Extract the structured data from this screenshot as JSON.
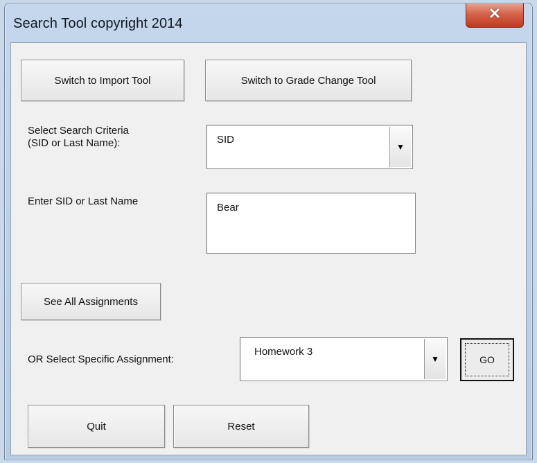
{
  "window": {
    "title": "Search Tool copyright 2014",
    "close_glyph": "✕"
  },
  "toolbar": {
    "import_label": "Switch to Import Tool",
    "grade_change_label": "Switch to Grade Change Tool"
  },
  "criteria": {
    "label_line1": "Select Search Criteria",
    "label_line2": "(SID or Last Name):",
    "value": "SID"
  },
  "search": {
    "label": "Enter SID or Last Name",
    "value": "Bear"
  },
  "assignments": {
    "see_all_label": "See All Assignments",
    "specific_label": "OR Select Specific Assignment:",
    "selected": "Homework 3",
    "go_label": "GO"
  },
  "footer": {
    "quit_label": "Quit",
    "reset_label": "Reset"
  },
  "icons": {
    "dropdown": "▼"
  }
}
